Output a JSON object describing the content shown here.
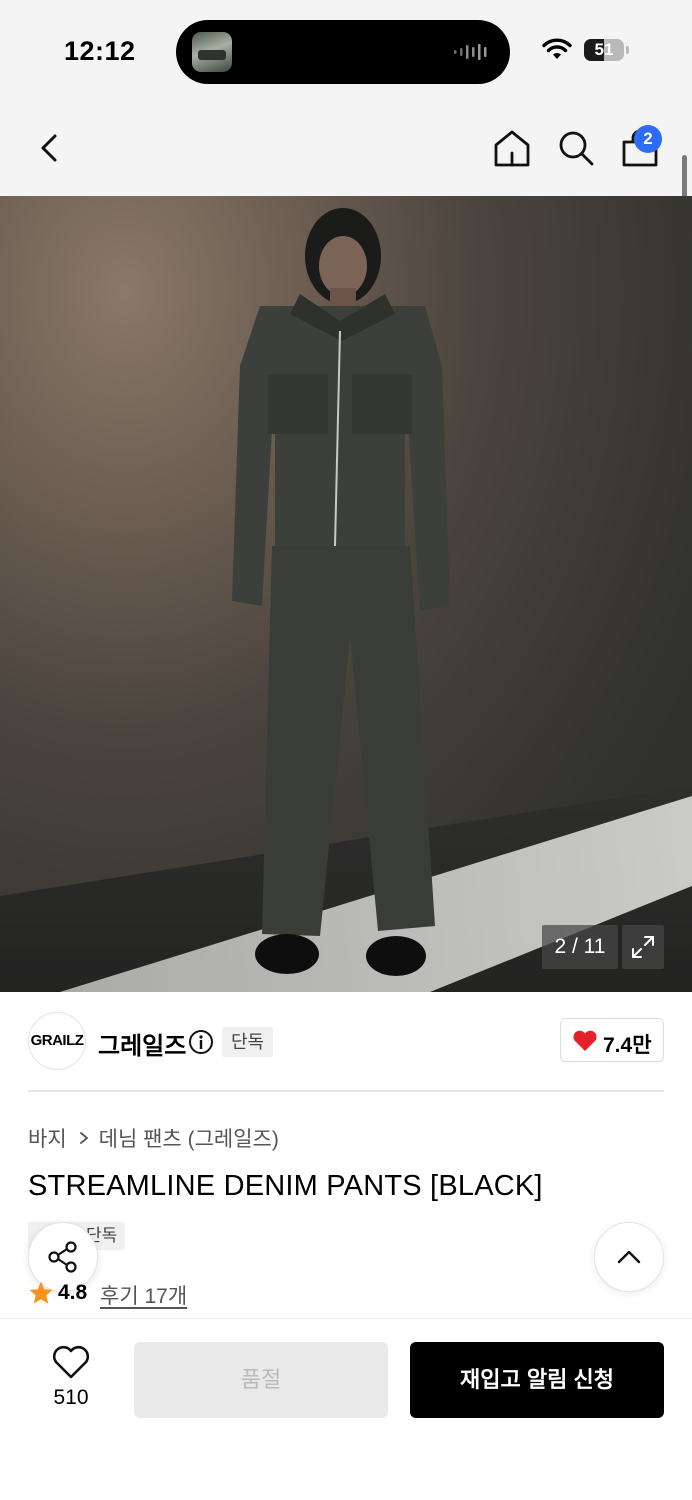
{
  "status_bar": {
    "time": "12:12",
    "battery": "51",
    "battery_level": 0.51
  },
  "nav": {
    "cart_count": "2",
    "icons": [
      "back-icon",
      "home-icon",
      "search-icon",
      "shopping-bag-icon"
    ]
  },
  "gallery": {
    "counter": "2 / 11"
  },
  "brand": {
    "logo_text": "GRAILZ",
    "name": "그레일즈",
    "exclusive_label": "단독",
    "likes": "7.4만"
  },
  "product": {
    "breadcrumb": [
      "바지",
      "데님 팬츠 (그레일즈)"
    ],
    "title": "STREAMLINE DENIM PANTS [BLACK]",
    "tag": "단독",
    "rating": "4.8",
    "reviews": "후기 17개"
  },
  "actions": {
    "wish_count": "510",
    "soldout_label": "품절",
    "restock_label": "재입고 알림 신청"
  },
  "colors": {
    "accent_blue": "#2f6cf6",
    "heart_red": "#e8202c",
    "star_orange": "#f7941d",
    "primary_black": "#000000"
  }
}
